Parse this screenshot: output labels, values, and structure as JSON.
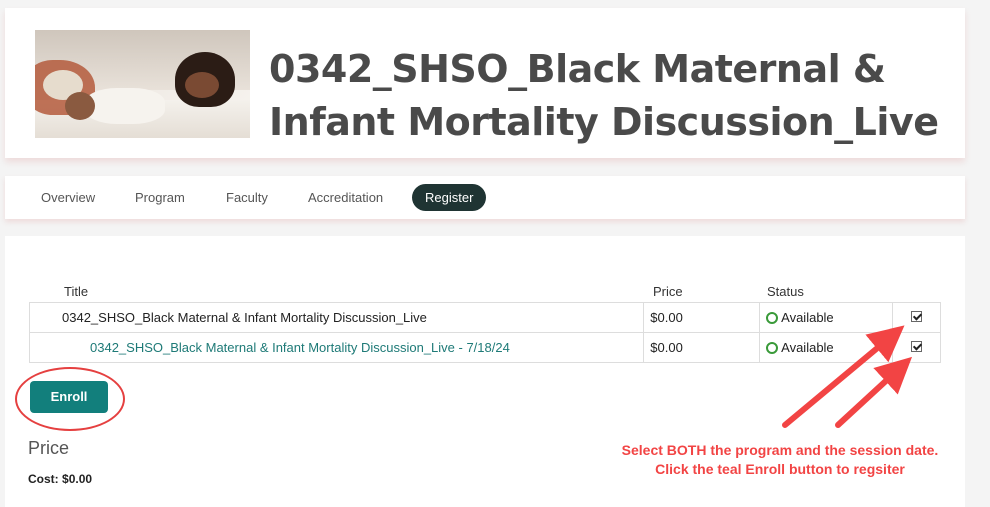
{
  "header": {
    "title": "0342_SHSO_Black Maternal & Infant Mortality Discussion_Live"
  },
  "tabs": [
    {
      "label": "Overview"
    },
    {
      "label": "Program"
    },
    {
      "label": "Faculty"
    },
    {
      "label": "Accreditation"
    },
    {
      "label": "Register",
      "active": true
    }
  ],
  "table": {
    "columns": [
      "Title",
      "Price",
      "Status"
    ],
    "rows": [
      {
        "title": "0342_SHSO_Black Maternal & Infant Mortality Discussion_Live",
        "price": "$0.00",
        "status": "Available",
        "checked": true
      },
      {
        "title": "0342_SHSO_Black Maternal & Infant Mortality Discussion_Live - 7/18/24",
        "price": "$0.00",
        "status": "Available",
        "checked": true
      }
    ]
  },
  "enroll_label": "Enroll",
  "price": {
    "heading": "Price",
    "cost_label": "Cost:",
    "cost_value": "$0.00"
  },
  "annotation": {
    "line1": "Select BOTH the program and the session date.",
    "line2": "Click the teal Enroll button to regsiter"
  },
  "colors": {
    "accent_teal": "#127f7c",
    "active_tab": "#1f3433",
    "annotation_red": "#f24444"
  }
}
